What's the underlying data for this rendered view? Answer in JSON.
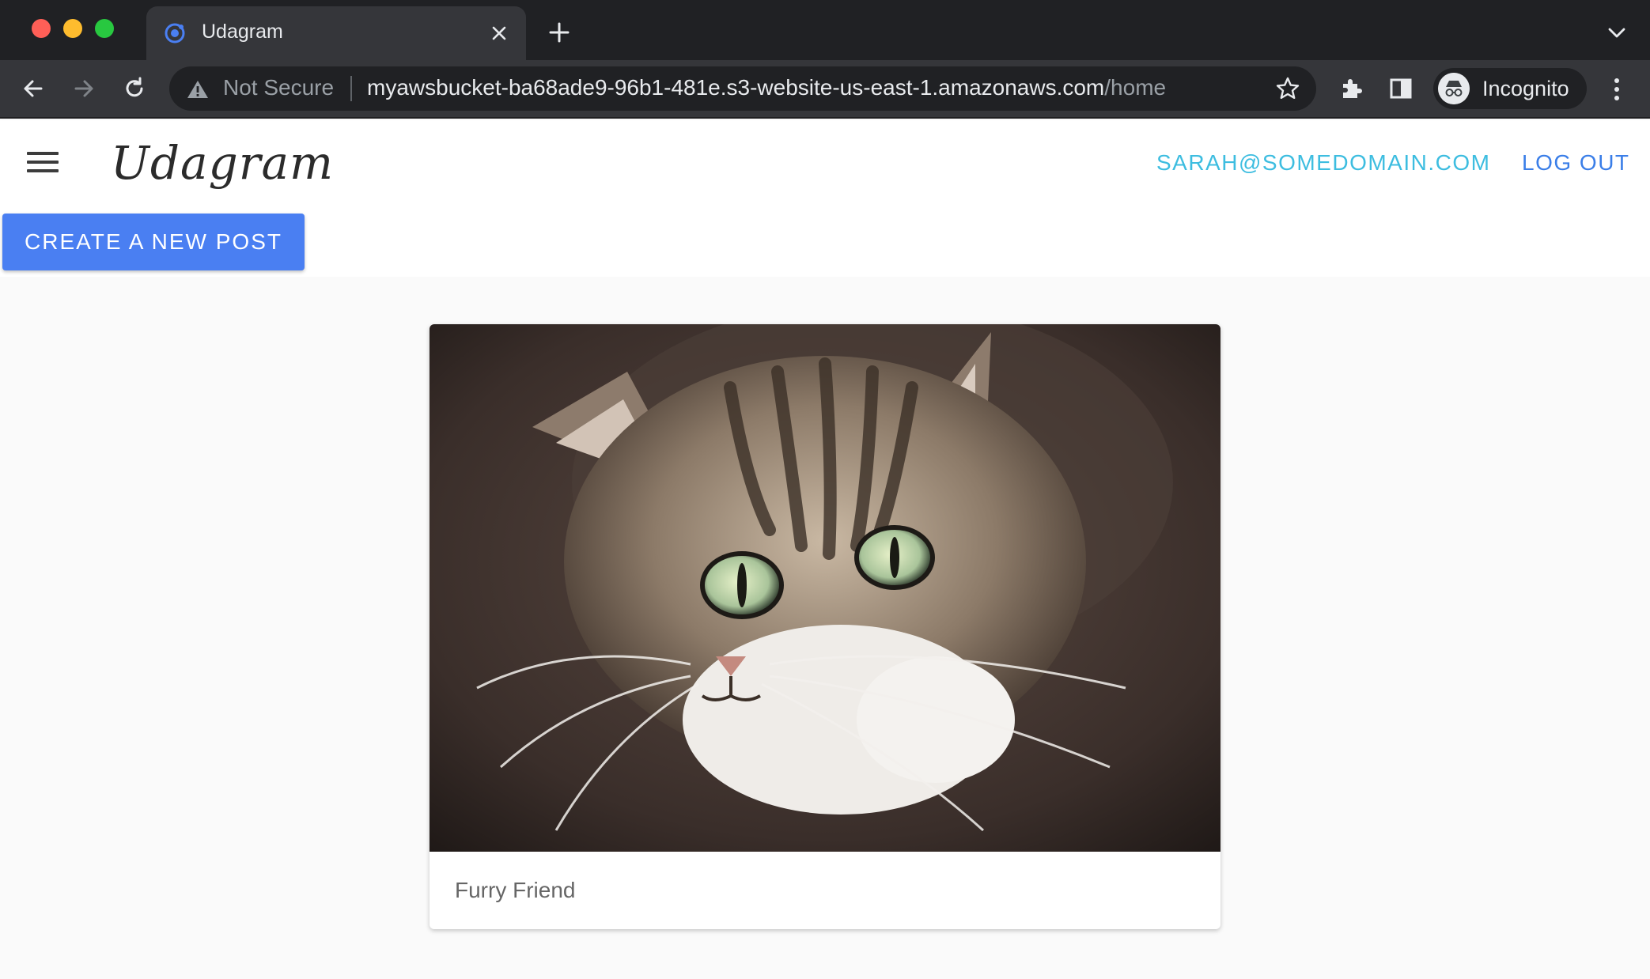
{
  "browser": {
    "tab_title": "Udagram",
    "security_label": "Not Secure",
    "url_host": "myawsbucket-ba68ade9-96b1-481e.s3-website-us-east-1.amazonaws.com",
    "url_path": "/home",
    "profile_label": "Incognito"
  },
  "header": {
    "brand": "Udagram",
    "user_email": "SARAH@SOMEDOMAIN.COM",
    "logout_label": "LOG OUT"
  },
  "actions": {
    "create_post_label": "CREATE A NEW POST"
  },
  "feed": {
    "posts": [
      {
        "caption": "Furry Friend",
        "image": "tabby-cat-photo"
      }
    ]
  },
  "colors": {
    "accent_button": "#4a7ff2",
    "email_link": "#3dbde0",
    "logout_link": "#3a7ee8"
  }
}
